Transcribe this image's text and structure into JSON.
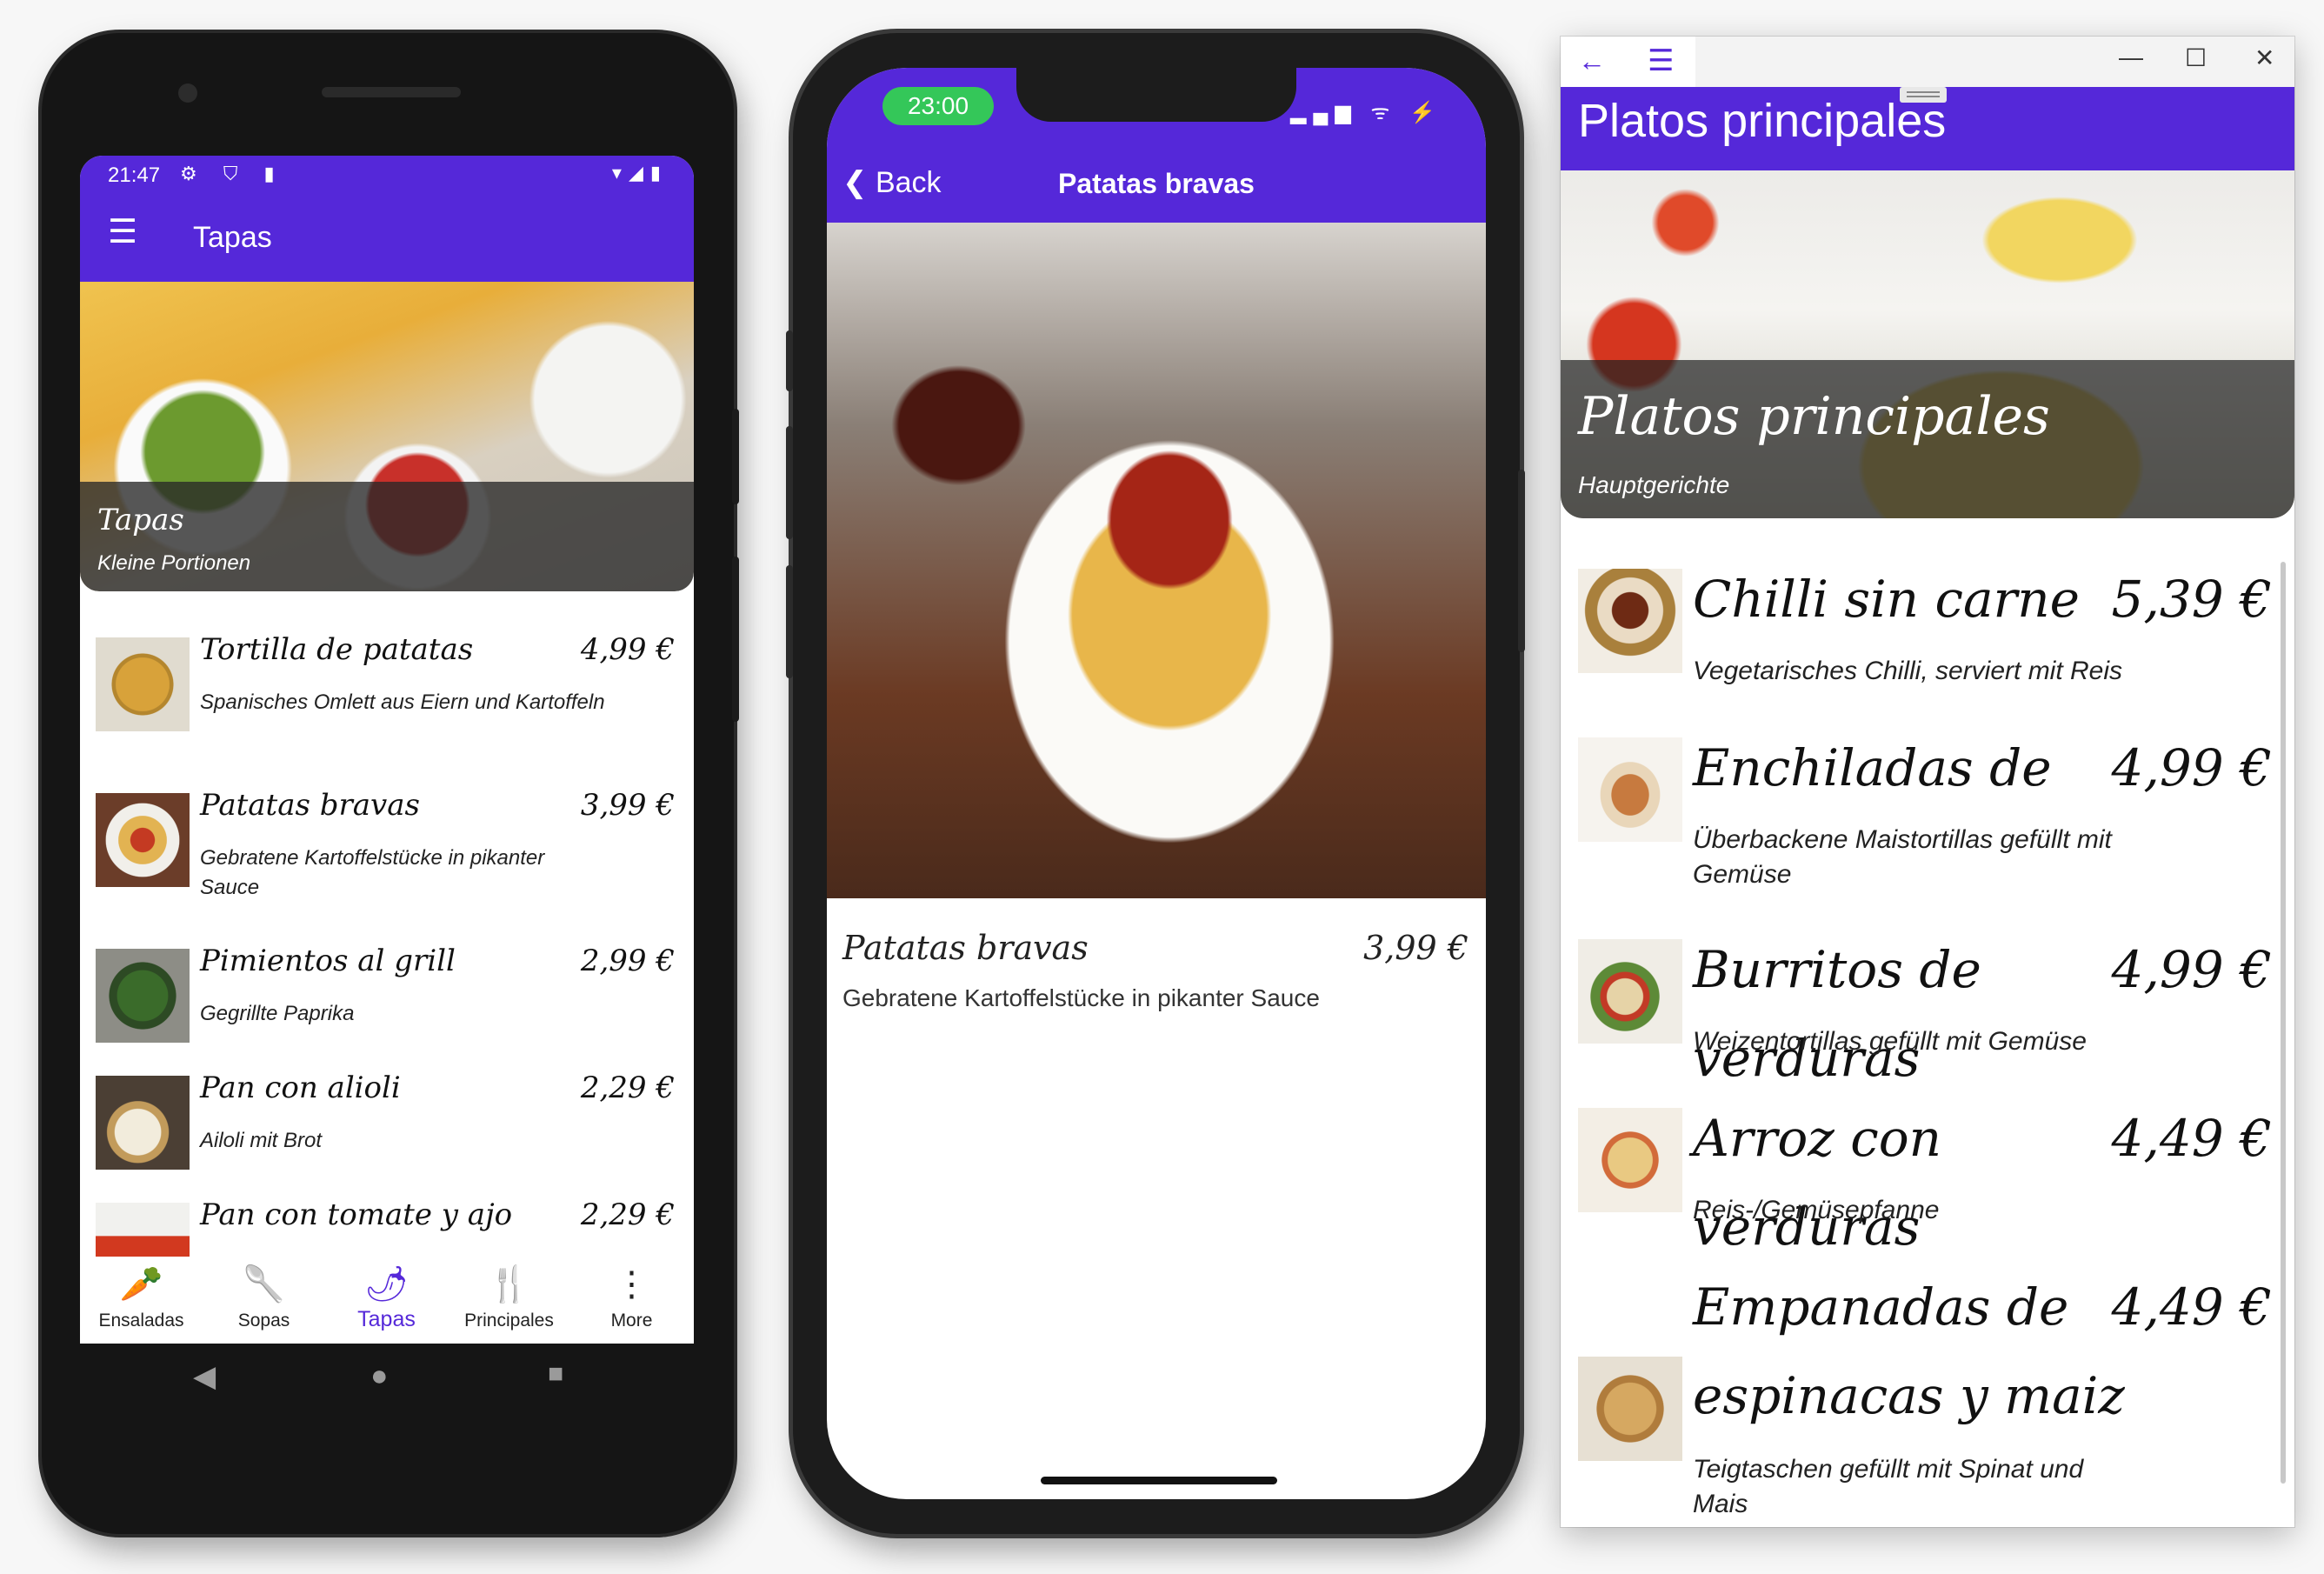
{
  "android": {
    "status": {
      "time": "21:47",
      "left_icons": "⚙ ⛉ ▮",
      "right_icons": "▾◢▮"
    },
    "appbar": {
      "menu_icon": "☰",
      "title": "Tapas"
    },
    "hero": {
      "title": "Tapas",
      "subtitle": "Kleine Portionen"
    },
    "items": [
      {
        "name": "Tortilla de patatas",
        "price": "4,99 €",
        "desc": "Spanisches Omlett aus Eiern und Kartoffeln",
        "image": "tortilla-photo"
      },
      {
        "name": "Patatas bravas",
        "price": "3,99 €",
        "desc": "Gebratene Kartoffelstücke in pikanter Sauce",
        "image": "bravas-photo"
      },
      {
        "name": "Pimientos al grill",
        "price": "2,99 €",
        "desc": "Gegrillte Paprika",
        "image": "pimientos-photo"
      },
      {
        "name": "Pan con alioli",
        "price": "2,29 €",
        "desc": "Ailoli mit Brot",
        "image": "alioli-photo"
      },
      {
        "name": "Pan con tomate y ajo",
        "price": "2,29 €",
        "desc": "",
        "image": "pan-tomate-photo"
      }
    ],
    "tabs": [
      {
        "label": "Ensaladas",
        "icon": "carrot-icon",
        "glyph": "🥕"
      },
      {
        "label": "Sopas",
        "icon": "ladle-icon",
        "glyph": "🥄"
      },
      {
        "label": "Tapas",
        "icon": "pepper-icon",
        "glyph": "🌶"
      },
      {
        "label": "Principales",
        "icon": "cutlery-icon",
        "glyph": "🍴"
      },
      {
        "label": "More",
        "icon": "more-icon",
        "glyph": "⋮"
      }
    ],
    "active_tab": "Tapas",
    "nav": {
      "back": "◀",
      "home": "●",
      "recents": "■"
    }
  },
  "iphone": {
    "status": {
      "time": "23:00",
      "right_icons": "▂▄▆ ᯤ ⚡"
    },
    "nav": {
      "back_label": "Back",
      "title": "Patatas bravas"
    },
    "item": {
      "name": "Patatas bravas",
      "price": "3,99 €",
      "desc": "Gebratene Kartoffelstücke in pikanter Sauce"
    }
  },
  "windows": {
    "titlebar": {
      "back_glyph": "←",
      "menu_glyph": "☰",
      "minimize": "—",
      "maximize": "☐",
      "close": "✕"
    },
    "header": {
      "title": "Platos principales"
    },
    "hero": {
      "title": "Platos principales",
      "subtitle": "Hauptgerichte"
    },
    "items": [
      {
        "name": "Chilli sin carne",
        "price": "5,39 €",
        "desc": "Vegetarisches Chilli, serviert mit Reis",
        "image": "chilli-photo"
      },
      {
        "name": "Enchiladas de",
        "price": "4,99 €",
        "desc": "Überbackene Maistortillas gefüllt mit Gemüse",
        "image": "enchiladas-photo"
      },
      {
        "name": "Burritos de verduras",
        "price": "4,99 €",
        "desc": "Weizentortillas gefüllt mit Gemüse",
        "image": "burritos-photo"
      },
      {
        "name": "Arroz con verduras",
        "price": "4,49 €",
        "desc": "Reis-/Gemüsepfanne",
        "image": "arroz-photo"
      },
      {
        "name": "Empanadas de espinacas y maiz",
        "price": "4,49 €",
        "desc": "Teigtaschen gefüllt mit Spinat und Mais",
        "image": "empanadas-photo"
      }
    ]
  },
  "colors": {
    "accent": "#5528d9",
    "ios_green": "#34c759"
  }
}
